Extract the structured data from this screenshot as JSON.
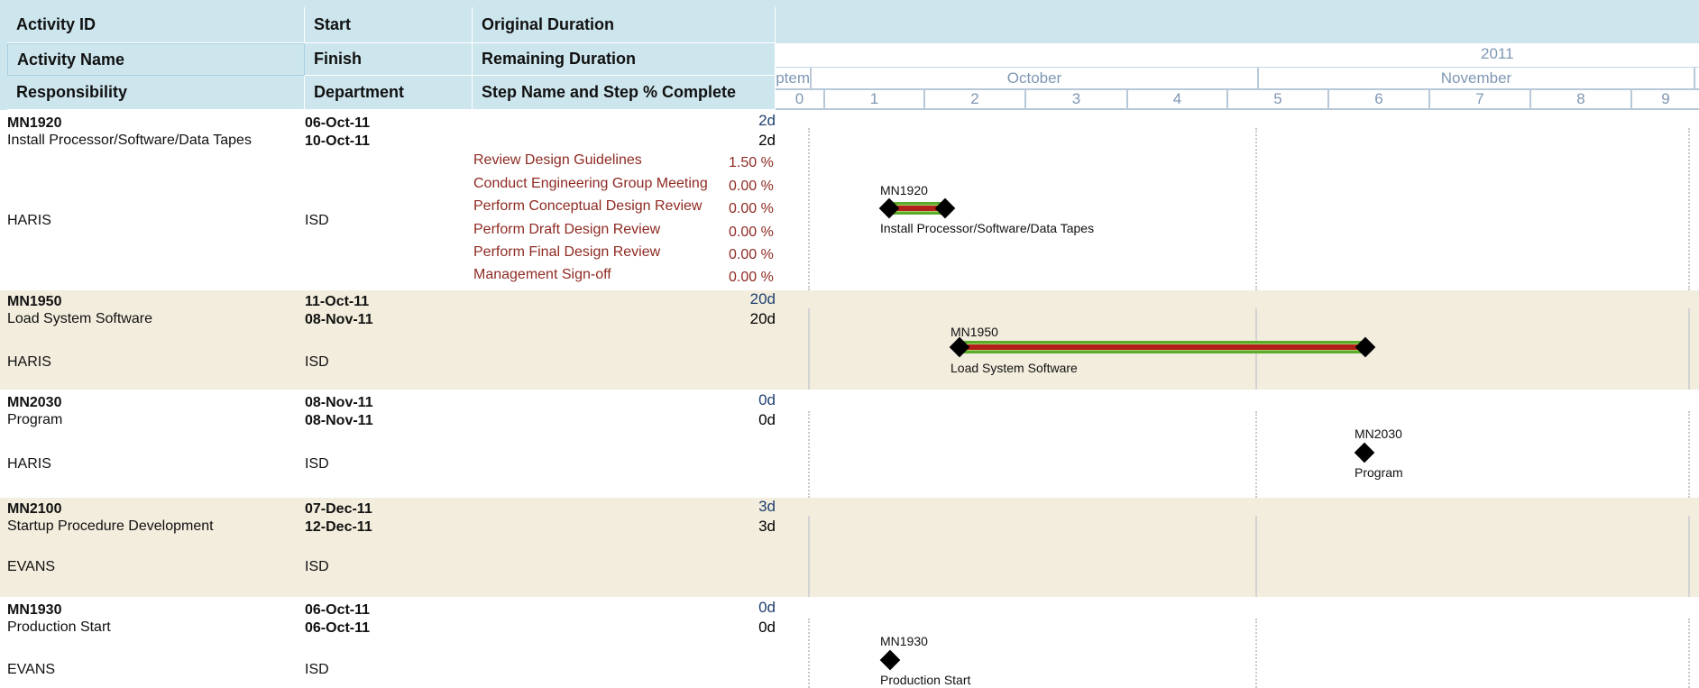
{
  "columns": {
    "activity_id": "Activity ID",
    "start": "Start",
    "original_duration": "Original Duration",
    "activity_name": "Activity Name",
    "finish": "Finish",
    "remaining_duration": "Remaining Duration",
    "responsibility": "Responsibility",
    "department": "Department",
    "step_name": "Step Name and Step % Complete"
  },
  "timeline": {
    "year": "2011",
    "months": [
      "ptem",
      "October",
      "November",
      ""
    ],
    "weeks": [
      "0",
      "1",
      "2",
      "3",
      "4",
      "5",
      "6",
      "7",
      "8",
      "9"
    ]
  },
  "rows": [
    {
      "id": "MN1920",
      "name": "Install Processor/Software/Data Tapes",
      "start": "06-Oct-11",
      "finish": "10-Oct-11",
      "orig_dur": "2d",
      "rem_dur": "2d",
      "responsibility": "HARIS",
      "department": "ISD",
      "steps": [
        {
          "name": "Review Design Guidelines",
          "pct": "1.50 %"
        },
        {
          "name": "Conduct Engineering Group Meeting",
          "pct": "0.00 %"
        },
        {
          "name": "Perform Conceptual Design Review",
          "pct": "0.00 %"
        },
        {
          "name": "Perform Draft Design Review",
          "pct": "0.00 %"
        },
        {
          "name": "Perform Final Design Review",
          "pct": "0.00 %"
        },
        {
          "name": "Management Sign-off",
          "pct": "0.00 %"
        }
      ],
      "bar_id": "MN1920",
      "bar_name": "Install Processor/Software/Data Tapes"
    },
    {
      "id": "MN1950",
      "name": "Load System Software",
      "start": "11-Oct-11",
      "finish": "08-Nov-11",
      "orig_dur": "20d",
      "rem_dur": "20d",
      "responsibility": "HARIS",
      "department": "ISD",
      "bar_id": "MN1950",
      "bar_name": "Load System Software"
    },
    {
      "id": "MN2030",
      "name": "Program",
      "start": "08-Nov-11",
      "finish": "08-Nov-11",
      "orig_dur": "0d",
      "rem_dur": "0d",
      "responsibility": "HARIS",
      "department": "ISD",
      "bar_id": "MN2030",
      "bar_name": "Program"
    },
    {
      "id": "MN2100",
      "name": "Startup Procedure Development",
      "start": "07-Dec-11",
      "finish": "12-Dec-11",
      "orig_dur": "3d",
      "rem_dur": "3d",
      "responsibility": "EVANS",
      "department": "ISD"
    },
    {
      "id": "MN1930",
      "name": "Production Start",
      "start": "06-Oct-11",
      "finish": "06-Oct-11",
      "orig_dur": "0d",
      "rem_dur": "0d",
      "responsibility": "EVANS",
      "department": "ISD",
      "bar_id": "MN1930",
      "bar_name": "Production Start"
    }
  ],
  "colors": {
    "header_bg": "#cde6ee",
    "alt_row_bg": "#f2eddd",
    "bar_progress": "#b3201a",
    "bar_remaining": "#5dab2b",
    "step_text": "#8e2a22"
  }
}
